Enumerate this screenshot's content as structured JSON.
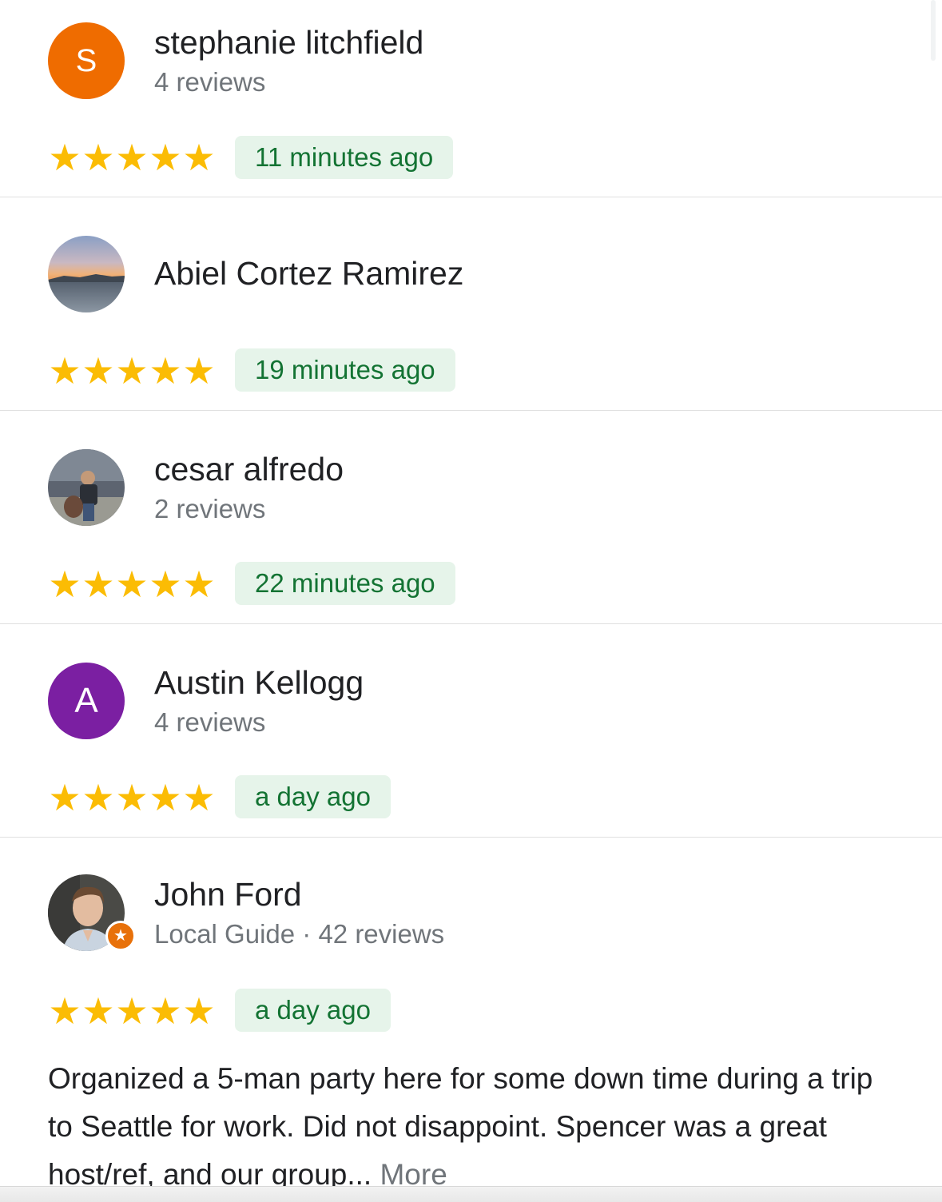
{
  "reviews": [
    {
      "name": "stephanie litchfield",
      "meta": "4 reviews",
      "avatar_initial": "S",
      "avatar_color": "#ef6c00",
      "rating": 5,
      "time": "11 minutes ago"
    },
    {
      "name": "Abiel Cortez Ramirez",
      "meta": "",
      "avatar_initial": "",
      "avatar_color": "",
      "avatar_type": "photo-sunset",
      "rating": 5,
      "time": "19 minutes ago"
    },
    {
      "name": "cesar alfredo",
      "meta": "2 reviews",
      "avatar_initial": "",
      "avatar_type": "photo-person",
      "rating": 5,
      "time": "22 minutes ago"
    },
    {
      "name": "Austin Kellogg",
      "meta": "4 reviews",
      "avatar_initial": "A",
      "avatar_color": "#7b1fa2",
      "rating": 5,
      "time": "a day ago"
    },
    {
      "name": "John Ford",
      "meta": "Local Guide · 42 reviews",
      "avatar_initial": "",
      "avatar_type": "photo-portrait",
      "local_guide_badge": true,
      "rating": 5,
      "time": "a day ago",
      "text": "Organized a 5-man party here for some down time during a trip to Seattle for work. Did not disappoint. Spencer was a great host/ref, and our group...",
      "more_label": "More"
    }
  ],
  "colors": {
    "star": "#fbbc04",
    "chip_bg": "#e6f4ea",
    "chip_text": "#137333",
    "divider": "#e0e0e0"
  },
  "icons": {
    "star": "star-icon",
    "local_guide": "local-guide-star-icon"
  }
}
